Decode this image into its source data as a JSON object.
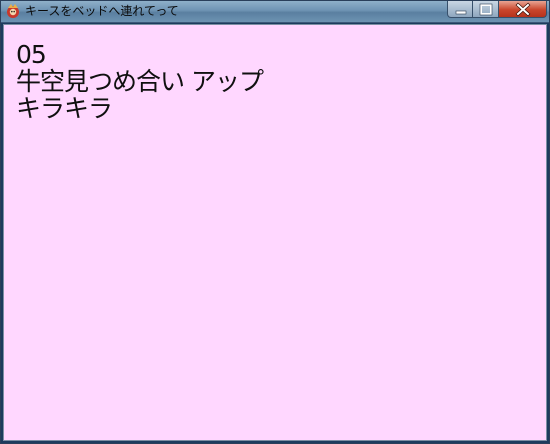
{
  "window": {
    "title": "キースをベッドへ連れてって",
    "icon": "game-app-icon",
    "controls": [
      "minimize",
      "maximize",
      "close"
    ]
  },
  "content": {
    "background_color": "#ffd7ff",
    "lines": [
      "05",
      "牛空見つめ合い アップ",
      "キラキラ"
    ]
  }
}
